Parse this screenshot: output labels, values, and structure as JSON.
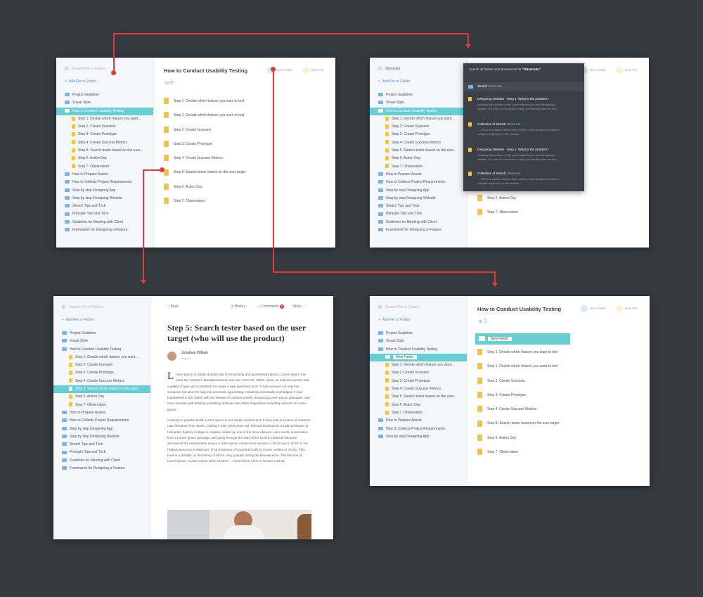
{
  "sidebar": {
    "search_placeholder": "Search File or Folders",
    "add_label": "Add File or Folder",
    "items": [
      {
        "label": "Project Guideline",
        "level": 0,
        "type": "folder"
      },
      {
        "label": "Visual Style",
        "level": 0,
        "type": "folder"
      },
      {
        "label": "How to Conduct Usability Testing",
        "level": 0,
        "type": "folder"
      },
      {
        "label": "Step 1: Decide which feature you want...",
        "level": 1,
        "type": "doc"
      },
      {
        "label": "Step 2: Create Scenario",
        "level": 1,
        "type": "doc"
      },
      {
        "label": "Step 3: Create Prototype",
        "level": 1,
        "type": "doc"
      },
      {
        "label": "Step 4: Create Success Metrics",
        "level": 1,
        "type": "doc"
      },
      {
        "label": "Step 5: Search tester based on the user...",
        "level": 1,
        "type": "doc"
      },
      {
        "label": "Step 6: Action Day",
        "level": 1,
        "type": "doc"
      },
      {
        "label": "Step 7: Observation",
        "level": 1,
        "type": "doc"
      },
      {
        "label": "How to Prepare Assets",
        "level": 0,
        "type": "folder"
      },
      {
        "label": "How to Collects Project Requirements",
        "level": 0,
        "type": "folder"
      },
      {
        "label": "Step by step Designing App",
        "level": 0,
        "type": "folder"
      },
      {
        "label": "Step by step Designing Website",
        "level": 0,
        "type": "folder"
      },
      {
        "label": "Sketch Tips and Trick",
        "level": 0,
        "type": "folder"
      },
      {
        "label": "Principle Tips and Trick",
        "level": 0,
        "type": "folder"
      },
      {
        "label": "Guideline for Meeting with Client",
        "level": 0,
        "type": "folder"
      },
      {
        "label": "Framework for Designing a Feature",
        "level": 0,
        "type": "folder"
      }
    ],
    "new_folder_label": "New Folder"
  },
  "main": {
    "title": "How to Conduct Usability Testing",
    "new_folder_btn": "New Folder",
    "new_file_btn": "New File",
    "docs": [
      "Step 1: Decide which feature you want to test",
      "Step 1: Decide which feature you want to test",
      "Step 2: Create Scenario",
      "Step 3: Create Prototype",
      "Step 4: Create Success Metrics",
      "Step 5: Search tester based on the user target",
      "Step 6: Action Day",
      "Step 7: Observation"
    ],
    "new_folder_row": "New Folder"
  },
  "search": {
    "query": "Shortcuts",
    "popup_prefix": "Search all folders and documents for",
    "popup_query": "\"Shortcuts\"",
    "results": [
      {
        "title_pre": "Sketch ",
        "title_hl": "Shortcuts",
        "body": "",
        "type": "folder"
      },
      {
        "title_pre": "Designing Website - Step 1: What is the problem?",
        "title_hl": "",
        "body_lines": [
          "Knowing the problem is the good beginning to start designing a",
          "website. It's kind of a shortcuts to help you identify what are the..."
        ],
        "type": "doc"
      },
      {
        "title_pre": "Collection of Sketch ",
        "title_hl": "Shortcuts",
        "body_lines": [
          "... This is a shortcut that is often used by most designers to hide or",
          "collapse all groups on the sidebar..."
        ],
        "type": "doc"
      },
      {
        "title_pre": "Designing Website - Step 1: What is the problem?",
        "title_hl": "",
        "body_lines": [
          "Knowing the problem is the good beginning to start designing a",
          "website. It's kind of a shortcuts to help you identify what are the..."
        ],
        "type": "doc"
      },
      {
        "title_pre": "Collection of Sketch ",
        "title_hl": "Shortcuts",
        "body_lines": [
          "... This is a shortcut that is often used by most designers to hide or",
          "collapse all groups on the sidebar..."
        ],
        "type": "doc"
      }
    ],
    "visible_docs": [
      "Step 6: Action Day",
      "Step 7: Observation"
    ]
  },
  "article": {
    "back_label": "Back",
    "history_label": "History",
    "comments_label": "Comments",
    "comments_count": "2",
    "more_label": "More",
    "title": "Step 5: Search tester based on the user target (who will use the product)",
    "author": "Jonathan William",
    "date": "Aug 20",
    "dropcap": "L",
    "p1": "orem Ipsum is simply dummy text of the printing and typesetting industry. Lorem Ipsum has been the industry's standard dummy text ever since the 1500s, when an unknown printer took a galley of type and scrambled it to make a type specimen book. It has survived not only five centuries, but also the leap into electronic typesetting, remaining essentially unchanged. It was popularised in the 1960s with the release of Letraset sheets containing Lorem Ipsum passages, and more recently with desktop publishing software like Aldus PageMaker including versions of Lorem Ipsum.",
    "p2": "Contrary to popular belief, Lorem Ipsum is not simply random text. It has roots in a piece of classical Latin literature from 45 BC, making it over 2000 years old. Richard McClintock, a Latin professor at Hampden-Sydney College in Virginia, looked up one of the more obscure Latin words, consectetur, from a Lorem Ipsum passage, and going through the cites of the word in classical literature, discovered the undoubtable source. Lorem Ipsum comes from sections 1.10.32 and 1.10.33 of \"de Finibus Bonorum et Malorum\" (The Extremes of Good and Evil) by Cicero, written in 45 BC. This book is a treatise on the theory of ethics, very popular during the Renaissance. The first line of Lorem Ipsum, \"Lorem ipsum dolor sit amet..\", comes from a line in section 1.10.32."
  },
  "colors": {
    "background": "#353a41",
    "accent": "#67cfd4",
    "arrow": "#e53935",
    "folder": "#7bb2ec",
    "doc": "#f5c43d"
  }
}
